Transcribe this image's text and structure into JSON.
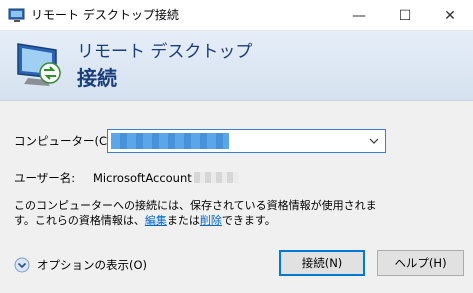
{
  "window": {
    "title": "リモート デスクトップ接続",
    "minimize_glyph": "—",
    "maximize_glyph": "☐",
    "close_glyph": "✕"
  },
  "banner": {
    "line1": "リモート デスクトップ",
    "line2": "接続",
    "icon": "remote-desktop-icon"
  },
  "form": {
    "computer_label": "コンピューター(C):",
    "computer_value": "redacted",
    "user_label": "ユーザー名:",
    "user_value": "MicrosoftAccount"
  },
  "info": {
    "line1": "このコンピューターへの接続には、保存されている資格情報が使用されま",
    "line2_prefix": "す。これらの資格情報は、",
    "edit_link": "編集",
    "middle": "または",
    "delete_link": "削除",
    "line2_suffix": "できます。"
  },
  "options": {
    "label": "オプションの表示(O)",
    "icon": "chevron-down-circle-icon"
  },
  "buttons": {
    "connect": "接続(N)",
    "help": "ヘルプ(H)"
  },
  "colors": {
    "banner_text": "#1a3d7c",
    "accent": "#0078d7",
    "link": "#0066cc"
  }
}
